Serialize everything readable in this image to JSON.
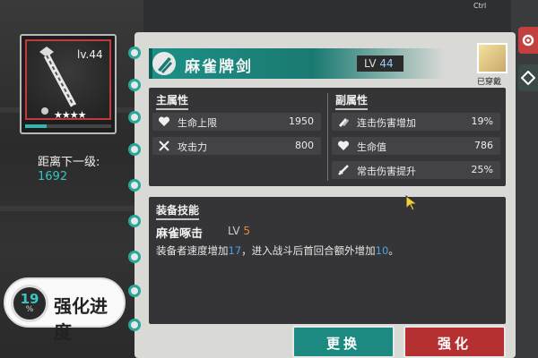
{
  "system": {
    "ctrl_label": "Ctrl"
  },
  "weapon_card": {
    "level": "lv.44",
    "stars": "★★★★",
    "exp_fraction": 0.25
  },
  "next_level": {
    "label": "距离下一级:",
    "value": "1692"
  },
  "enhance_progress": {
    "value": "19",
    "unit": "%",
    "label": "强化进度"
  },
  "header": {
    "weapon_name": "麻雀牌剑",
    "lv_label": "LV",
    "lv_value": "44"
  },
  "character": {
    "equipped_label": "已穿戴"
  },
  "main_stats": {
    "title": "主属性",
    "rows": [
      {
        "icon": "heart-icon",
        "name": "生命上限",
        "value": "1950"
      },
      {
        "icon": "crossed-swords-icon",
        "name": "攻击力",
        "value": "800"
      }
    ]
  },
  "sub_stats": {
    "title": "副属性",
    "rows": [
      {
        "icon": "combo-icon",
        "name": "连击伤害增加",
        "value": "19%"
      },
      {
        "icon": "heart-icon",
        "name": "生命值",
        "value": "786"
      },
      {
        "icon": "sword-icon",
        "name": "常击伤害提升",
        "value": "25%"
      }
    ]
  },
  "skill": {
    "title": "装备技能",
    "name": "麻雀啄击",
    "lv_label": "LV",
    "lv_value": "5",
    "desc_part1": "装备者速度增加",
    "desc_num1": "17",
    "desc_part2": "，进入战斗后首回合额外增加",
    "desc_num2": "10",
    "desc_part3": "。"
  },
  "buttons": {
    "replace": "更换",
    "enhance": "强化"
  },
  "colors": {
    "teal": "#1c8a80",
    "red": "#b53030",
    "highlight_blue": "#4aa3e8",
    "level_orange": "#e08a3c"
  }
}
